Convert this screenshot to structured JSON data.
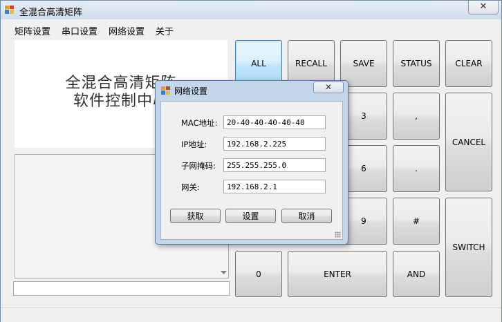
{
  "window": {
    "title": "全混合高清矩阵",
    "close_glyph": "✕"
  },
  "menu": [
    {
      "label": "矩阵设置"
    },
    {
      "label": "串口设置"
    },
    {
      "label": "网络设置"
    },
    {
      "label": "关于"
    }
  ],
  "logo": {
    "line1": "全混合高清矩阵",
    "line2": "软件控制中心"
  },
  "keypad": {
    "all": "ALL",
    "recall": "RECALL",
    "save": "SAVE",
    "status": "STATUS",
    "clear": "CLEAR",
    "k3": "3",
    "comma": ",",
    "cancel": "CANCEL",
    "k6": "6",
    "dot": ".",
    "k9": "9",
    "hash": "#",
    "switch": "SWITCH",
    "k0": "0",
    "enter": "ENTER",
    "and": "AND"
  },
  "dialog": {
    "title": "网络设置",
    "close_glyph": "✕",
    "mac_label": "MAC地址:",
    "mac_value": "20-40-40-40-40-40",
    "ip_label": "IP地址:",
    "ip_value": "192.168.2.225",
    "mask_label": "子网掩码:",
    "mask_value": "255.255.255.0",
    "gw_label": "网关:",
    "gw_value": "192.168.2.1",
    "get_btn": "获取",
    "set_btn": "设置",
    "cancel_btn": "取消"
  },
  "icons": {
    "app": "app-icon",
    "scroll": "scroll-down-arrow-icon"
  }
}
